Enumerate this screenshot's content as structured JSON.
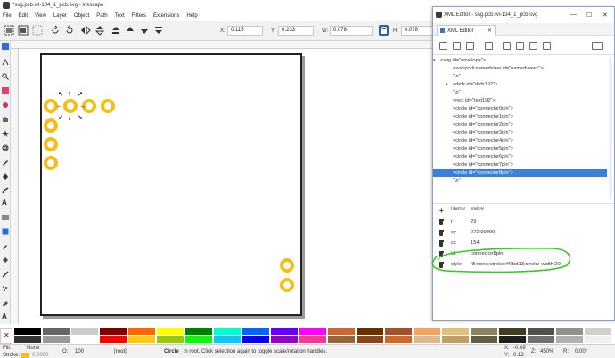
{
  "window": {
    "title": "*svg.pcb.wl-134_1_pcb.svg - Inkscape"
  },
  "menu": [
    "File",
    "Edit",
    "View",
    "Layer",
    "Object",
    "Path",
    "Text",
    "Filters",
    "Extensions",
    "Help"
  ],
  "toolbar": {
    "x_label": "X:",
    "x_value": "0.115",
    "y_label": "Y:",
    "y_value": "0.233",
    "w_label": "W:",
    "w_value": "0.078",
    "h_label": "H:",
    "h_value": "0.078"
  },
  "canvas": {
    "connector_color": "#f7bd13",
    "handle_symbols": [
      "↖",
      "↑",
      "↗",
      "←",
      "→",
      "↙",
      "↓",
      "↘"
    ]
  },
  "palette": {
    "colors": [
      "#000000",
      "#333333",
      "#666666",
      "#999999",
      "#cccccc",
      "#ffffff",
      "#800000",
      "#ff0000",
      "#ff6600",
      "#ffcc00",
      "#ffff00",
      "#99cc00",
      "#008000",
      "#00ff00",
      "#00ffcc",
      "#00ccff",
      "#0066ff",
      "#0000ff",
      "#6600ff",
      "#9900cc",
      "#ff00ff",
      "#ff3399",
      "#cc6633",
      "#996633",
      "#663300",
      "#8b4513",
      "#a0522d",
      "#d2691e",
      "#f4a460",
      "#deb887",
      "#e0c080",
      "#c0a060",
      "#8b8060",
      "#606040",
      "#404020",
      "#202020",
      "#505050",
      "#707070",
      "#909090",
      "#b0b0b0",
      "#d0d0d0",
      "#f0f0f0"
    ]
  },
  "status": {
    "fill_label": "Fill:",
    "fill_value": "None",
    "stroke_label": "Stroke:",
    "opacity_value": "0.2000",
    "opacity_num": "100",
    "layer_value": "[root]",
    "message_bold": "Circle",
    "message": " in root. Click selection again to toggle scale/rotation handles.",
    "x_label": "X:",
    "x_value": "-0.09",
    "y_label": "Y:",
    "y_value": "0.13",
    "z_label": "Z:",
    "zoom_value": "450%",
    "r_label": "R:",
    "rotation_value": "0.00°"
  },
  "xml_editor": {
    "title": "XML Editor - svg.pcb.wl-134_1_pcb.svg",
    "tab_label": "XML Editor",
    "tree": [
      {
        "text": "<svg id=\"envelope\">",
        "indent": 0,
        "toggle": "▾"
      },
      {
        "text": "<sodipodi:namedview id=\"namedview1\">",
        "indent": 1,
        "toggle": ""
      },
      {
        "text": "\"\\n\"",
        "indent": 1,
        "toggle": ""
      },
      {
        "text": "<defs id=\"defs192\">",
        "indent": 1,
        "toggle": "▸"
      },
      {
        "text": "\"\\n\"",
        "indent": 1,
        "toggle": ""
      },
      {
        "text": "<rect id=\"rect192\">",
        "indent": 1,
        "toggle": ""
      },
      {
        "text": "<circle id=\"connector0pin\">",
        "indent": 1,
        "toggle": ""
      },
      {
        "text": "<circle id=\"connector1pin\">",
        "indent": 1,
        "toggle": ""
      },
      {
        "text": "<circle id=\"connector2pin\">",
        "indent": 1,
        "toggle": ""
      },
      {
        "text": "<circle id=\"connector3pin\">",
        "indent": 1,
        "toggle": ""
      },
      {
        "text": "<circle id=\"connector4pin\">",
        "indent": 1,
        "toggle": ""
      },
      {
        "text": "<circle id=\"connector5pin\">",
        "indent": 1,
        "toggle": ""
      },
      {
        "text": "<circle id=\"connector6pin\">",
        "indent": 1,
        "toggle": ""
      },
      {
        "text": "<circle id=\"connector7pin\">",
        "indent": 1,
        "toggle": ""
      },
      {
        "text": "<circle id=\"connector8pin\">",
        "indent": 1,
        "toggle": "",
        "selected": true
      },
      {
        "text": "\"\\n\"",
        "indent": 1,
        "toggle": ""
      }
    ],
    "attr_headers": {
      "name": "Name",
      "value": "Value"
    },
    "attributes": [
      {
        "name": "r",
        "value": "29"
      },
      {
        "name": "cy",
        "value": "272.00009"
      },
      {
        "name": "cx",
        "value": "154"
      },
      {
        "name": "id",
        "value": "connector8pin"
      },
      {
        "name": "style",
        "value": "fill:none;stroke:#f7bd13;stroke-width:20"
      }
    ],
    "highlight_color": "#33cc22"
  }
}
